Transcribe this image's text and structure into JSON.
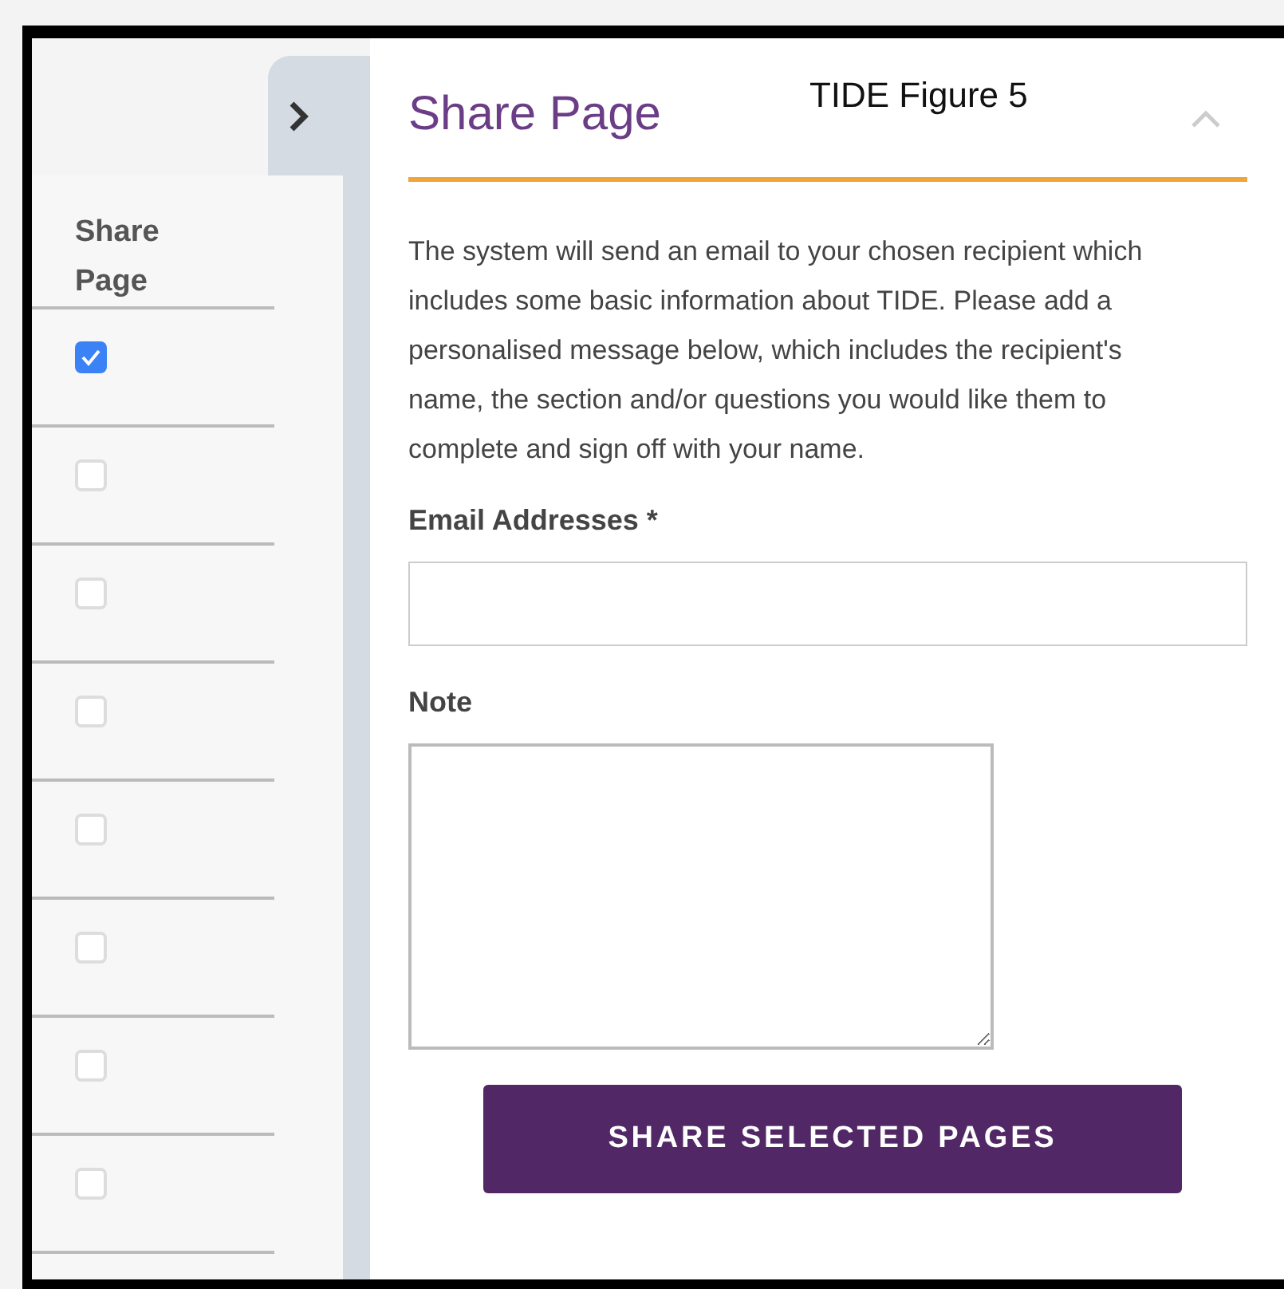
{
  "share_column": {
    "heading": "Share Page",
    "rows": [
      {
        "checked": true
      },
      {
        "checked": false
      },
      {
        "checked": false
      },
      {
        "checked": false
      },
      {
        "checked": false
      },
      {
        "checked": false
      },
      {
        "checked": false
      },
      {
        "checked": false
      }
    ]
  },
  "panel": {
    "title": "Share Page",
    "figure_label": "TIDE Figure 5",
    "description": "The system will send an email to your chosen recipient which includes some basic information about TIDE. Please add a personalised message below, which includes the recipient's name, the section and/or questions you would like them to complete and sign off with your name.",
    "email_label": "Email Addresses *",
    "note_label": "Note",
    "button": "SHARE SELECTED PAGES"
  }
}
